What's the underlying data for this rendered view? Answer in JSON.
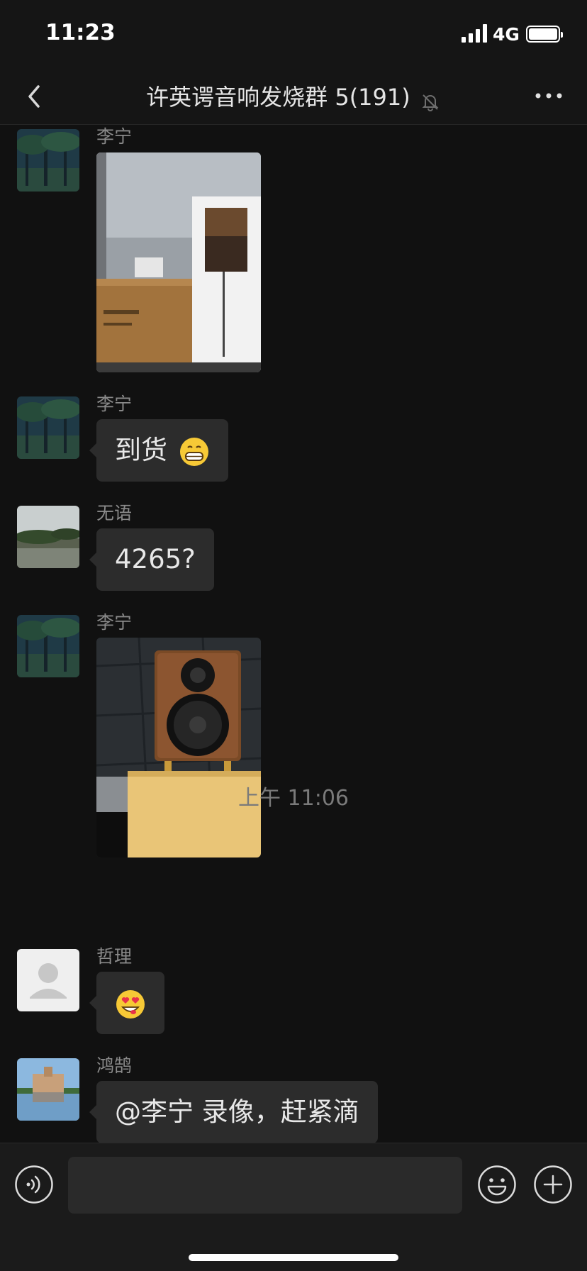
{
  "status_bar": {
    "time": "11:23",
    "network": "4G",
    "battery_level": 1.0
  },
  "nav": {
    "title": "许英谔音响发烧群 5(191)",
    "back_icon": "chevron-left-icon",
    "mute_icon": "bell-muted-icon",
    "more_icon": "ellipsis-icon"
  },
  "messages": [
    {
      "sender": "李宁",
      "type": "image",
      "image": "boxed speaker and white stand photo"
    },
    {
      "sender": "李宁",
      "type": "text",
      "text": "到货",
      "emoji": "grinning-face-icon"
    },
    {
      "sender": "无语",
      "type": "text",
      "text": "4265?"
    },
    {
      "sender": "李宁",
      "type": "image",
      "image": "wooden bookshelf speaker photo"
    },
    {
      "sender": "哲理",
      "type": "emoji",
      "emoji": "heart-eyes-face-icon"
    },
    {
      "sender": "鸿鹄",
      "type": "text",
      "text": "@李宁 录像，赶紧滴"
    }
  ],
  "timestamp": "上午 11:06",
  "input_bar": {
    "voice_icon": "voice-icon",
    "emoji_icon": "smiley-icon",
    "plus_icon": "plus-icon",
    "placeholder": ""
  },
  "colors": {
    "background": "#111111",
    "bubble": "#2c2c2c",
    "sender": "#8a8a8a",
    "bar": "#1b1b1b"
  }
}
